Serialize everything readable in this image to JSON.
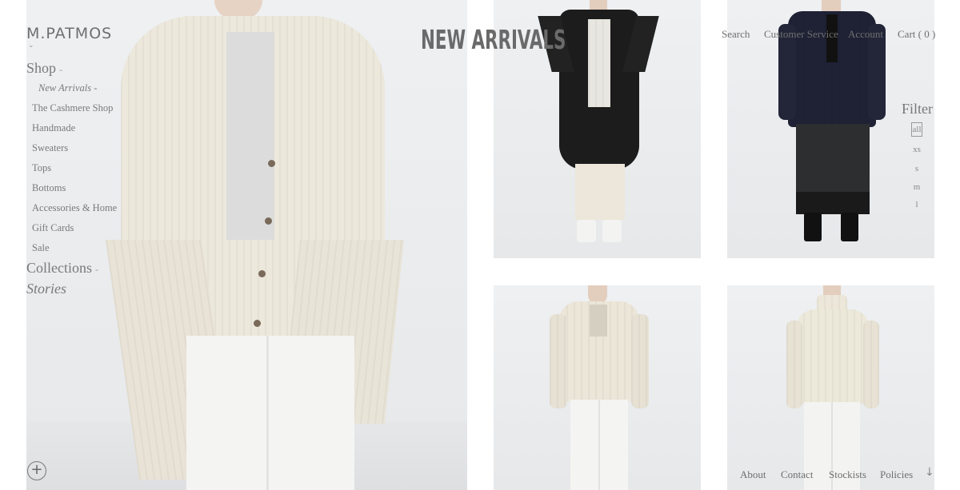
{
  "brand": {
    "logo": "M.PATMOS",
    "caret": "⌄"
  },
  "page": {
    "title": "NEW ARRIVALS"
  },
  "topnav": {
    "search": "Search",
    "customer_service": "Customer Service",
    "account": "Account",
    "cart": "Cart ( 0 )"
  },
  "sidenav": {
    "shop": "Shop",
    "shop_dash": "-",
    "new_arrivals": "New Arrivals -",
    "items": [
      "The Cashmere Shop",
      "Handmade",
      "Sweaters",
      "Tops",
      "Bottoms",
      "Accessories & Home",
      "Gift Cards",
      "Sale"
    ],
    "collections": "Collections",
    "collections_dash": "-",
    "stories": "Stories"
  },
  "filter": {
    "label": "Filter",
    "options": [
      "all",
      "xs",
      "s",
      "m",
      "l"
    ],
    "selected": "all"
  },
  "footer": {
    "about": "About",
    "contact": "Contact",
    "stockists": "Stockists",
    "policies": "Policies"
  },
  "icons": {
    "expand": "plus-circle-icon",
    "scroll": "arrow-down-icon"
  }
}
